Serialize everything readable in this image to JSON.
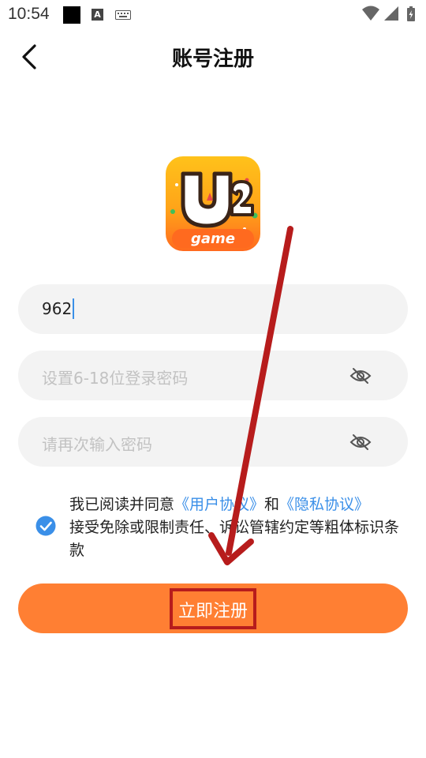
{
  "status_bar": {
    "time": "10:54",
    "icons": [
      "notification-square-icon",
      "a-notification-icon",
      "keyboard-icon",
      "wifi-icon",
      "signal-icon",
      "battery-charging-icon"
    ]
  },
  "header": {
    "title": "账号注册",
    "back_icon": "chevron-left-icon"
  },
  "logo": {
    "text_main": "U2",
    "text_sub": "game",
    "colors": {
      "top": "#ffc21a",
      "bottom": "#ff6a1f"
    }
  },
  "form": {
    "account": {
      "value": "962",
      "placeholder": ""
    },
    "password": {
      "value": "",
      "placeholder": "设置6-18位登录密码",
      "icon": "eye-off-icon"
    },
    "confirm_password": {
      "value": "",
      "placeholder": "请再次输入密码",
      "icon": "eye-off-icon"
    }
  },
  "agreement": {
    "checked": true,
    "prefix": "我已阅读并同意",
    "user_agreement": "《用户协议》",
    "and": "和",
    "privacy_agreement": "《隐私协议》",
    "suffix": "接受免除或限制责任、诉讼管辖约定等粗体标识条款"
  },
  "register_button": {
    "label": "立即注册"
  },
  "colors": {
    "accent": "#ff7f33",
    "link": "#3a8fe8",
    "annotation": "#b71c1c"
  }
}
